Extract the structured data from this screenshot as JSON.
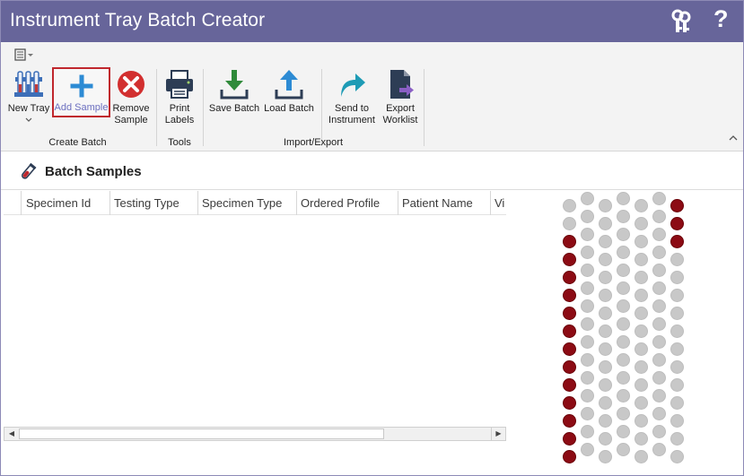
{
  "window": {
    "title": "Instrument Tray Batch Creator",
    "help_label": "?",
    "keys_icon": "keys-icon",
    "title_bar_color": "#67659a"
  },
  "ribbon": {
    "qat_icon": "quick-access-menu-icon",
    "groups": [
      {
        "label": "Create Batch"
      },
      {
        "label": "Tools"
      },
      {
        "label": "Import/Export"
      }
    ],
    "buttons": {
      "new_tray": {
        "line1": "New Tray",
        "line2": "",
        "icon": "test-tube-rack-icon"
      },
      "add_sample": {
        "line1": "Add Sample",
        "line2": "",
        "icon": "plus-icon",
        "selected": true
      },
      "remove_sample": {
        "line1": "Remove",
        "line2": "Sample",
        "icon": "remove-x-icon"
      },
      "print_labels": {
        "line1": "Print",
        "line2": "Labels",
        "icon": "printer-icon"
      },
      "save_batch": {
        "line1": "Save Batch",
        "line2": "",
        "icon": "download-tray-icon"
      },
      "load_batch": {
        "line1": "Load Batch",
        "line2": "",
        "icon": "upload-tray-icon"
      },
      "send_to_instrument": {
        "line1": "Send to",
        "line2": "Instrument",
        "icon": "forward-arrow-icon"
      },
      "export_worklist": {
        "line1": "Export",
        "line2": "Worklist",
        "icon": "export-document-icon"
      }
    },
    "accent_selected_border": "#c0272d"
  },
  "batch_samples": {
    "header": "Batch Samples",
    "icon": "blood-tube-icon",
    "columns": [
      "Specimen Id",
      "Testing Type",
      "Specimen Type",
      "Ordered Profile",
      "Patient Name",
      "Vi"
    ],
    "rows": []
  },
  "tray": {
    "filled_color": "#8c0b14",
    "empty_color": "#c8c8c8",
    "column_counts": [
      15,
      15,
      15,
      15,
      15,
      15,
      15
    ],
    "filled_wells": {
      "col0": [
        2,
        3,
        4,
        5,
        6,
        7,
        8,
        9,
        10,
        11,
        12,
        13,
        14
      ],
      "col6": [
        0,
        1,
        2
      ]
    }
  }
}
